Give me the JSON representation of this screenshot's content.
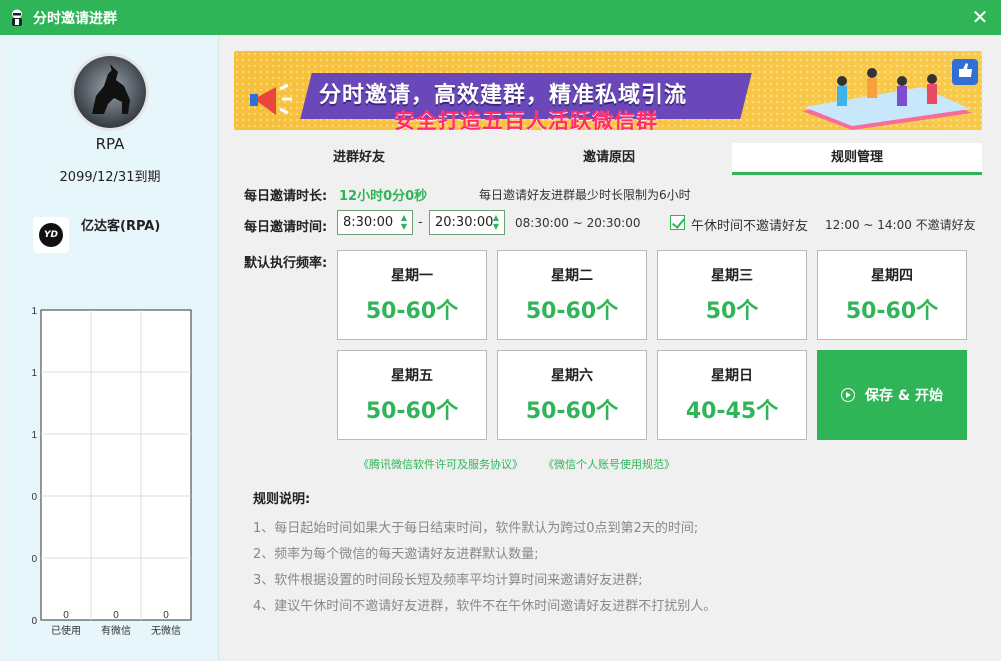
{
  "window": {
    "title": "分时邀请进群",
    "close_label": "✕"
  },
  "sidebar": {
    "user_name": "RPA",
    "expire": "2099/12/31到期",
    "brand_name": "亿达客(RPA)",
    "brand_logo_text": "YD"
  },
  "chart_data": {
    "type": "bar",
    "categories": [
      "已使用",
      "有微信",
      "无微信"
    ],
    "values": [
      0,
      0,
      0
    ],
    "data_labels": [
      "0",
      "0",
      "0"
    ],
    "y_tick_labels": [
      "0",
      "0",
      "0",
      "1",
      "1",
      "1"
    ],
    "ylim": [
      0,
      1
    ],
    "grid": true,
    "title": "",
    "xlabel": "",
    "ylabel": ""
  },
  "banner": {
    "line1": "分时邀请，高效建群，精准私域引流",
    "line2": "安全打造五百人活跃微信群"
  },
  "tabs": [
    {
      "label": "进群好友",
      "active": false
    },
    {
      "label": "邀请原因",
      "active": false
    },
    {
      "label": "规则管理",
      "active": true
    }
  ],
  "settings": {
    "duration_label": "每日邀请时长:",
    "duration_value": "12小时0分0秒",
    "duration_hint": "每日邀请好友进群最少时长限制为6小时",
    "time_label": "每日邀请时间:",
    "start_time": "8:30:00",
    "dash": "-",
    "end_time": "20:30:00",
    "time_range_text": "08:30:00 ~ 20:30:00",
    "lunch_checkbox_label": "午休时间不邀请好友",
    "lunch_checked": true,
    "lunch_hint": "12:00 ~ 14:00 不邀请好友",
    "freq_label": "默认执行频率:"
  },
  "days": [
    {
      "day": "星期一",
      "value": "50-60个"
    },
    {
      "day": "星期二",
      "value": "50-60个"
    },
    {
      "day": "星期三",
      "value": "50个"
    },
    {
      "day": "星期四",
      "value": "50-60个"
    },
    {
      "day": "星期五",
      "value": "50-60个"
    },
    {
      "day": "星期六",
      "value": "50-60个"
    },
    {
      "day": "星期日",
      "value": "40-45个"
    }
  ],
  "save_button": "保存 & 开始",
  "links": {
    "license": "《腾讯微信软件许可及服务协议》",
    "account_rules": "《微信个人账号使用规范》"
  },
  "rules": {
    "title": "规则说明:",
    "items": [
      "1、每日起始时间如果大于每日结束时间，软件默认为跨过0点到第2天的时间;",
      "2、频率为每个微信的每天邀请好友进群默认数量;",
      "3、软件根据设置的时间段长短及频率平均计算时间来邀请好友进群;",
      "4、建议午休时间不邀请好友进群，软件不在午休时间邀请好友进群不打扰别人。"
    ]
  },
  "colors": {
    "accent": "#2fb557",
    "banner_purple": "#6a48b9",
    "banner_pink": "#ff2d6f",
    "banner_yellow": "#f7c03a"
  }
}
